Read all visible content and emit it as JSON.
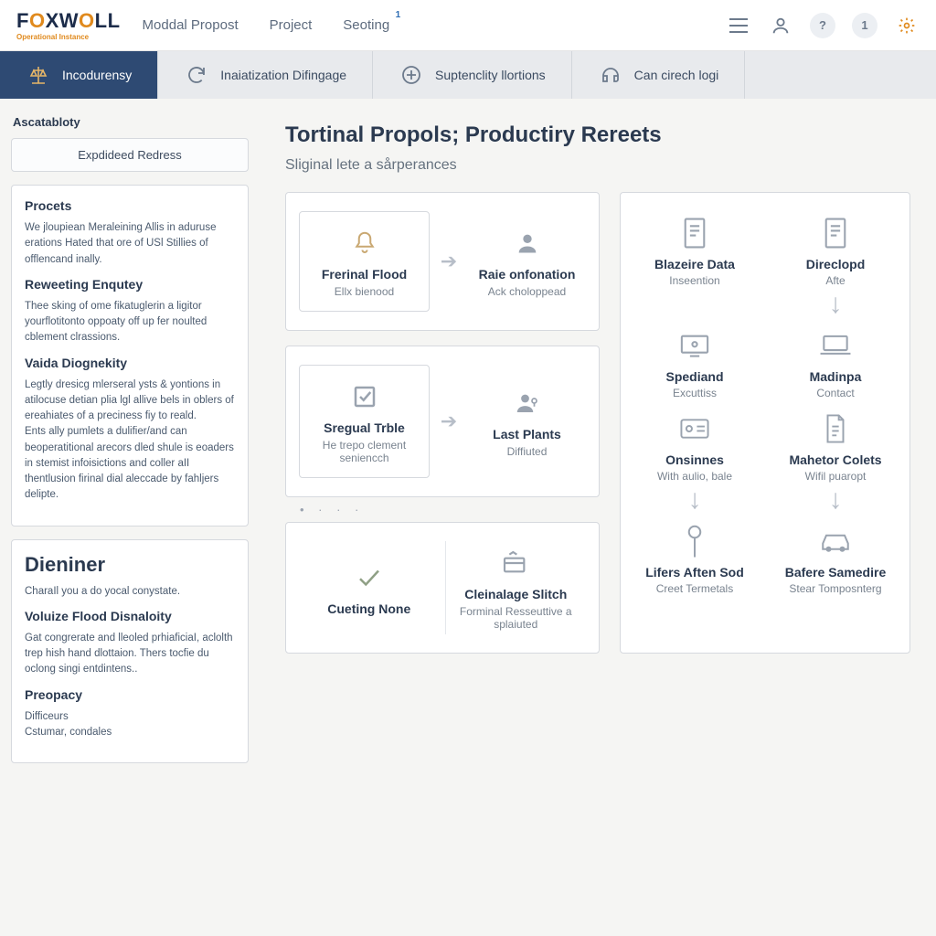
{
  "brand": {
    "name": "FOXWOLL",
    "tagline": "Operational Instance"
  },
  "top_nav": [
    {
      "label": "Moddal Propost"
    },
    {
      "label": "Project"
    },
    {
      "label": "Seoting",
      "badge": "1"
    }
  ],
  "top_icons": {
    "help": "?",
    "count": "1"
  },
  "tabs": [
    {
      "label": "Incodurensy",
      "active": true
    },
    {
      "label": "Inaiatization Difingage"
    },
    {
      "label": "Suptenclity llortions"
    },
    {
      "label": "Can cirech logi"
    }
  ],
  "sidebar": {
    "section": "Ascatabloty",
    "button": "Expdideed Redress",
    "panels": [
      {
        "title": "Procets",
        "body": "We jloupiean Meraleining Allis in aduruse erations Hated that ore of USl Stillies of offlencand inally.",
        "subs": [
          {
            "title": "Reweeting Enqutey",
            "body": "Thee sking of ome fikatuglerin a ligitor yourflotitonto oppoaty off up fer noulted cblement clrassions."
          },
          {
            "title": "Vaida Diognekity",
            "body": "Legtly dresicg mlerseral ysts & yontions in atilocuse detian plia lgl allive bels in oblers of ereahiates of a preciness fiy to reald.\nEnts ally pumlets a dulifier/and can beoperatitional arecors dled shule is eoaders in stemist infoisictions and coller aII thentlusion firinal dial aleccade by fahljers delipte."
          }
        ]
      },
      {
        "title": "Dieniner",
        "body": "CharaIl you a do yocal conystate.",
        "subs": [
          {
            "title": "Voluize Flood Disnaloity",
            "body": "Gat congrerate and lleoled prhiaficiaI, aclolth trep hish hand dlottaion. Thers tocfie du oclong singi entdintens.."
          },
          {
            "title": "Preopacy",
            "body": "Difficeurs\nCstumar, condales"
          }
        ]
      }
    ]
  },
  "main": {
    "title": "Tortinal Propols; Productiry Rereets",
    "subtitle": "Sliginal lete a sårperances",
    "col_a": [
      {
        "left": {
          "title": "Frerinal Flood",
          "sub": "Ellx bienood",
          "icon": "bell"
        },
        "right": {
          "title": "Raie onfonation",
          "sub": "Ack choloppead",
          "icon": "person"
        }
      },
      {
        "left": {
          "title": "Sregual Trble",
          "sub": "He trepo clement seniencch",
          "icon": "checkbox"
        },
        "right": {
          "title": "Last Plants",
          "sub": "Diffiuted",
          "icon": "person-key"
        }
      },
      {
        "left": {
          "title": "Cueting None",
          "sub": "",
          "icon": "check-flag"
        },
        "right": {
          "title": "Cleinalage Slitch",
          "sub": "Forminal Resseuttive a splaiuted",
          "icon": "card-swipe"
        }
      }
    ],
    "col_b": [
      {
        "title": "Blazeire Data",
        "sub": "Inseention",
        "icon": "doc-lines",
        "arrow": false
      },
      {
        "title": "Direclopd",
        "sub": "Afte",
        "icon": "doc-lines",
        "arrow": true
      },
      {
        "title": "Spediand",
        "sub": "Excuttiss",
        "icon": "device",
        "arrow": false
      },
      {
        "title": "Madinpa",
        "sub": "Contact",
        "icon": "laptop",
        "arrow": false
      },
      {
        "title": "Onsinnes",
        "sub": "With aulio, bale",
        "icon": "id-card",
        "arrow": true
      },
      {
        "title": "Mahetor Colets",
        "sub": "Wifil puaropt",
        "icon": "sheet",
        "arrow": true
      },
      {
        "title": "Lifers Aften Sod",
        "sub": "Creet Termetals",
        "icon": "pin",
        "arrow": false
      },
      {
        "title": "Bafere Samedire",
        "sub": "Stear Tomposnterg",
        "icon": "car",
        "arrow": false
      }
    ],
    "dots": "• · · ·"
  }
}
